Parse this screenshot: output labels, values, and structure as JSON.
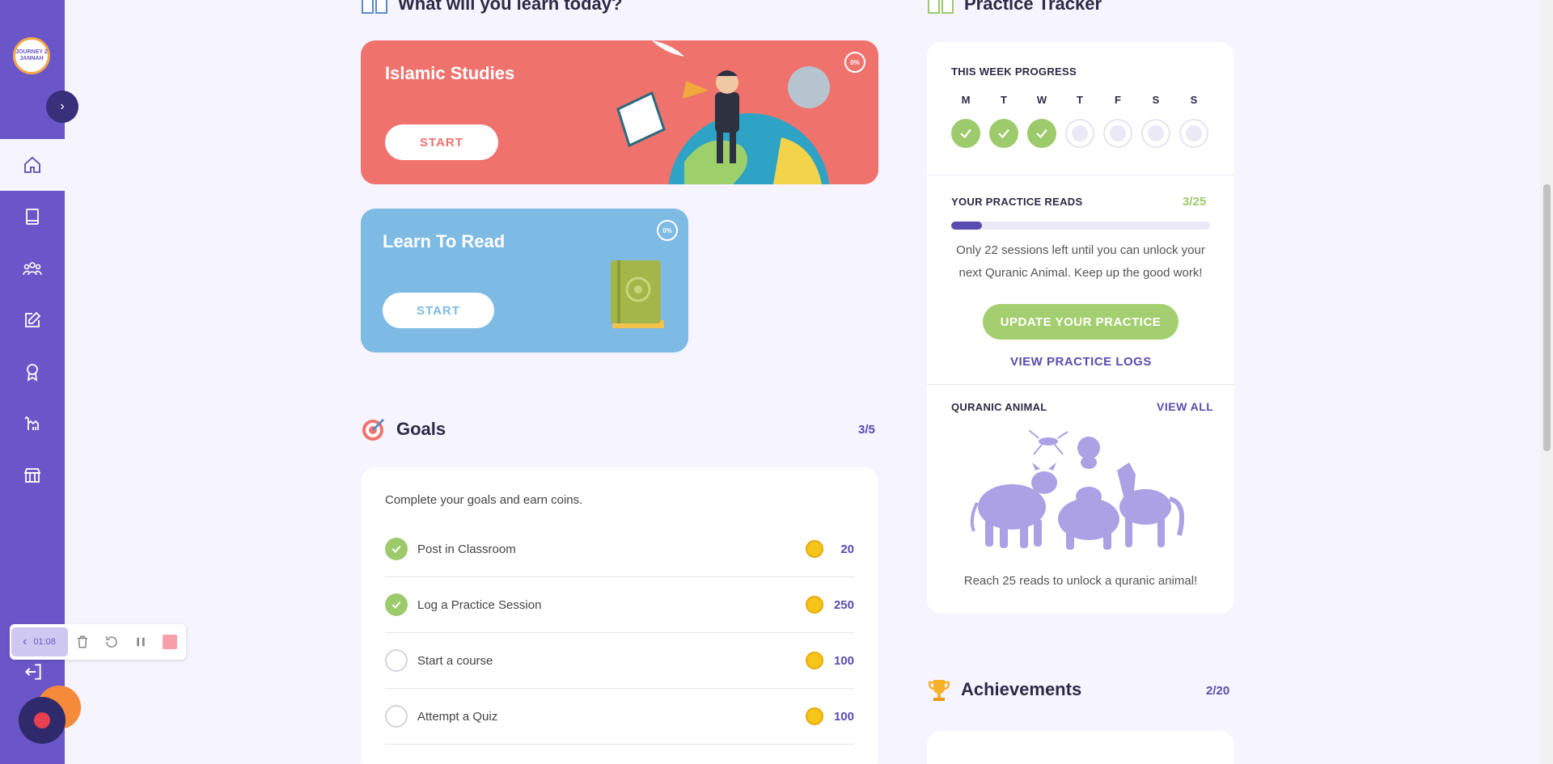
{
  "sidebar": {
    "logo_text": "JOURNEY 2 JANNAH",
    "items": [
      {
        "name": "home-icon",
        "active": true
      },
      {
        "name": "book-icon",
        "active": false
      },
      {
        "name": "users-icon",
        "active": false
      },
      {
        "name": "edit-icon",
        "active": false
      },
      {
        "name": "award-icon",
        "active": false
      },
      {
        "name": "camel-icon",
        "active": false
      },
      {
        "name": "store-icon",
        "active": false
      }
    ]
  },
  "recorder": {
    "time": "01:08"
  },
  "learn": {
    "title": "What will you learn today?",
    "courses": [
      {
        "title": "Islamic Studies",
        "button": "START",
        "progress": "0%",
        "color": "#ef726d"
      },
      {
        "title": "Learn To Read",
        "button": "START",
        "progress": "0%",
        "color": "#7dbae4"
      }
    ]
  },
  "goals": {
    "title": "Goals",
    "count": "3/5",
    "description": "Complete your goals and earn coins.",
    "items": [
      {
        "label": "Post in Classroom",
        "coins": "20",
        "done": true
      },
      {
        "label": "Log a Practice Session",
        "coins": "250",
        "done": true
      },
      {
        "label": "Start a course",
        "coins": "100",
        "done": false
      },
      {
        "label": "Attempt a Quiz",
        "coins": "100",
        "done": false
      }
    ]
  },
  "tracker": {
    "title": "Practice Tracker",
    "week_title": "THIS WEEK PROGRESS",
    "days": [
      {
        "label": "M",
        "done": true
      },
      {
        "label": "T",
        "done": true
      },
      {
        "label": "W",
        "done": true
      },
      {
        "label": "T",
        "done": false
      },
      {
        "label": "F",
        "done": false
      },
      {
        "label": "S",
        "done": false
      },
      {
        "label": "S",
        "done": false
      }
    ],
    "reads_title": "YOUR PRACTICE READS",
    "reads_count": "3/25",
    "reads_progress": 0.12,
    "reads_message": "Only 22 sessions left until you can unlock your next Quranic Animal. Keep up the good work!",
    "update_button": "UPDATE YOUR PRACTICE",
    "logs_link": "VIEW PRACTICE LOGS",
    "animal_title": "QURANIC ANIMAL",
    "animal_view_all": "VIEW ALL",
    "animal_message": "Reach 25 reads to unlock a quranic animal!"
  },
  "achievements": {
    "title": "Achievements",
    "count": "2/20"
  },
  "colors": {
    "accent": "#6a56c8",
    "green": "#9dca6b",
    "coin": "#f5c518"
  }
}
